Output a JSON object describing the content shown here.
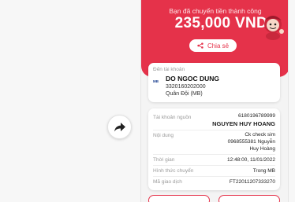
{
  "hero": {
    "title": "Bạn đã chuyển tiền thành công",
    "amount": "235,000 VND",
    "share_label": "Chia sẻ"
  },
  "recipient": {
    "label": "Đến tài khoản",
    "bank_logo_text": "MB",
    "name": "DO NGOC DUNG",
    "account_number": "3320160202000",
    "bank_name": "Quân Đội (MB)"
  },
  "details": {
    "source_label": "Tài khoản nguồn",
    "source_account": "6180196789999",
    "source_name": "NGUYEN HUY HOANG",
    "content_label": "Nội dung",
    "content_line1": "Ck check sim",
    "content_line2": "0968555381 Nguyễn",
    "content_line3": "Huy Hoàng",
    "time_label": "Thời gian",
    "time_value": "12:48:00, 11/01/2022",
    "method_label": "Hình thức chuyển",
    "method_value": "Trong MB",
    "txn_label": "Mã giao dịch",
    "txn_value": "FT22011207333270"
  },
  "colors": {
    "accent": "#e5324a",
    "background": "#f4f4f4"
  },
  "icons": {
    "fab": "share-arrow-icon",
    "share": "share-nodes-icon",
    "mascot": "mascot-icon"
  }
}
